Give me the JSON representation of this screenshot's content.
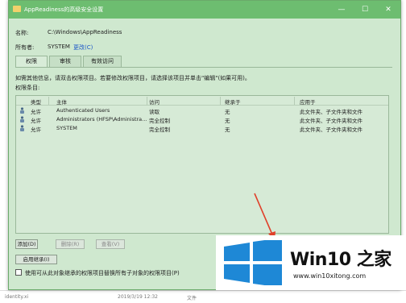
{
  "background_app": {
    "items": [
      "identity.xi",
      "2019/3/19 12:32",
      "文件"
    ]
  },
  "window": {
    "title": "AppReadiness的高级安全设置",
    "controls": {
      "minimize": "—",
      "maximize": "☐",
      "close": "✕"
    },
    "name_label": "名称:",
    "name_value": "C:\\Windows\\AppReadiness",
    "owner_label": "所有者:",
    "owner_value": "SYSTEM",
    "owner_change": "更改(C)",
    "tabs": [
      "权限",
      "审核",
      "有效访问"
    ],
    "info_text": "如需其他信息，请双击权限项目。若要修改权限项目，请选择该项目并单击\"编辑\"(如果可用)。",
    "entries_label": "权限条目:",
    "columns": [
      "类型",
      "主体",
      "访问",
      "继承于",
      "应用于"
    ],
    "rows": [
      {
        "type": "允许",
        "principal": "Authenticated Users",
        "access": "读取",
        "inherited": "无",
        "applies": "此文件夹、子文件夹和文件"
      },
      {
        "type": "允许",
        "principal": "Administrators (HFSP\\Administra...",
        "access": "完全控制",
        "inherited": "无",
        "applies": "此文件夹、子文件夹和文件"
      },
      {
        "type": "允许",
        "principal": "SYSTEM",
        "access": "完全控制",
        "inherited": "无",
        "applies": "此文件夹、子文件夹和文件"
      }
    ],
    "buttons": {
      "add": "添加(D)",
      "remove": "删除(R)",
      "view": "查看(V)",
      "enable_inheritance": "启用继承(I)"
    },
    "replace_checkbox": "使用可从此对象继承的权限项目替换所有子对象的权限项目(P)"
  },
  "watermark": {
    "brand": "Win10 之家",
    "url": "www.win10xitong.com"
  },
  "colors": {
    "window_bg": "#cfe8cf",
    "titlebar": "#6dbd70",
    "logo_blue": "#1e88d6",
    "arrow_red": "#e0402a"
  }
}
